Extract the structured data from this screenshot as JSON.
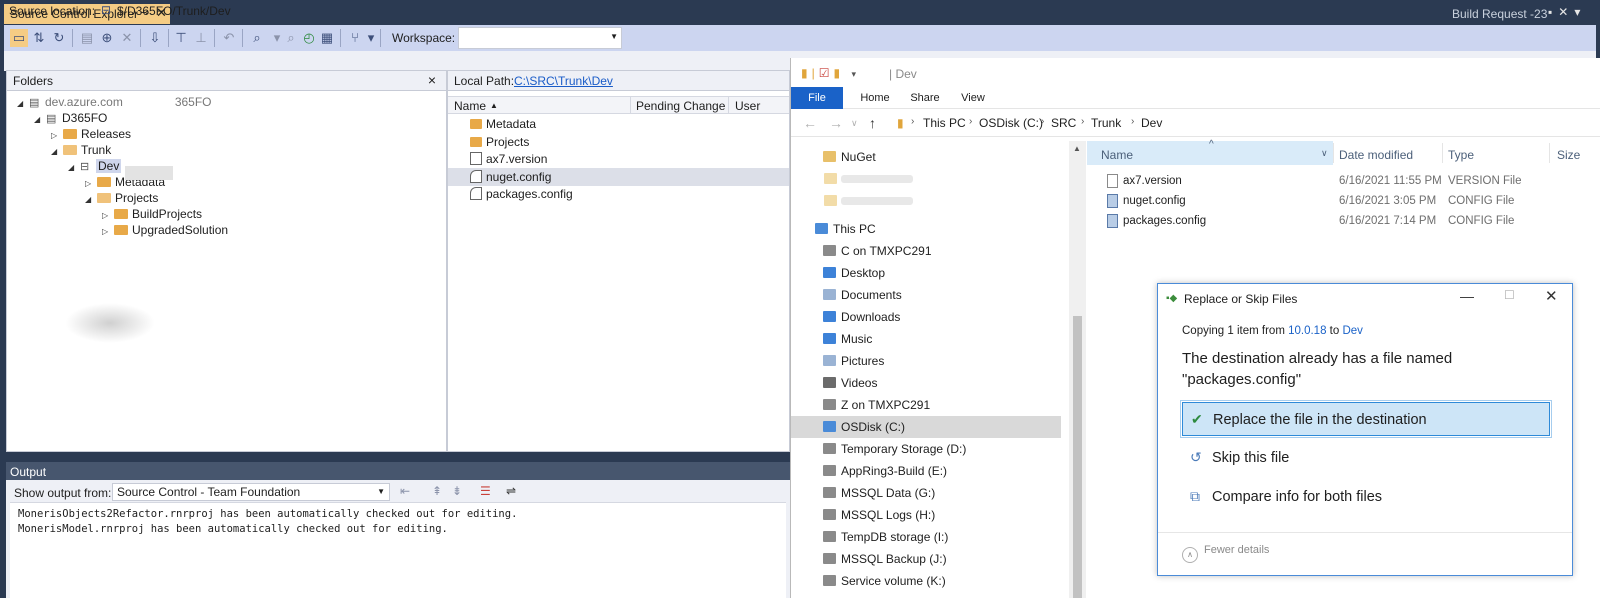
{
  "titlebar": {
    "tab_label": "Source Control Explorer",
    "pin_icon": "pin-icon",
    "close_icon": "close-icon",
    "right_label": "Build Request -23"
  },
  "toolbar": {
    "workspace_label": "Workspace:",
    "workspace_value": ""
  },
  "source_location": {
    "label": "Source location:",
    "path": "$/D365FO/Trunk/Dev"
  },
  "folders": {
    "title": "Folders",
    "tree": [
      {
        "label": "dev.azure.com",
        "suffix": "365FO",
        "indent": 0,
        "twisty": "◢",
        "icon": "server"
      },
      {
        "label": "D365FO",
        "indent": 1,
        "twisty": "◢",
        "icon": "server"
      },
      {
        "label": "Releases",
        "indent": 2,
        "twisty": "▷",
        "icon": "folder"
      },
      {
        "label": "Trunk",
        "indent": 2,
        "twisty": "◢",
        "icon": "folder-open"
      },
      {
        "label": "Dev",
        "indent": 3,
        "twisty": "◢",
        "icon": "branch",
        "selected": true
      },
      {
        "label": "Metadata",
        "indent": 4,
        "twisty": "▷",
        "icon": "folder"
      },
      {
        "label": "Projects",
        "indent": 4,
        "twisty": "◢",
        "icon": "folder-open"
      },
      {
        "label": "BuildProjects",
        "indent": 5,
        "twisty": "▷",
        "icon": "folder"
      },
      {
        "label": "UpgradedSolution",
        "indent": 5,
        "twisty": "▷",
        "icon": "folder"
      }
    ]
  },
  "items": {
    "local_path_label": "Local Path:",
    "local_path": "C:\\SRC\\Trunk\\Dev",
    "columns": [
      "Name",
      "Pending Change",
      "User"
    ],
    "rows": [
      {
        "name": "Metadata",
        "type": "folder"
      },
      {
        "name": "Projects",
        "type": "folder"
      },
      {
        "name": "ax7.version",
        "type": "doc"
      },
      {
        "name": "nuget.config",
        "type": "cfg",
        "selected": true
      },
      {
        "name": "packages.config",
        "type": "cfg"
      }
    ]
  },
  "output": {
    "title": "Output",
    "show_label": "Show output from:",
    "source": "Source Control - Team Foundation",
    "lines": [
      "MonerisObjects2Refactor.rnrproj has been automatically checked out for editing.",
      "MonerisModel.rnrproj has been automatically checked out for editing."
    ]
  },
  "explorer": {
    "window_title": "Dev",
    "ribbon_tabs": [
      "File",
      "Home",
      "Share",
      "View"
    ],
    "breadcrumb": [
      "This PC",
      "OSDisk (C:)",
      "SRC",
      "Trunk",
      "Dev"
    ],
    "nav_items": [
      {
        "label": "NuGet",
        "icon": "folder-icon",
        "color": "#e8c06a"
      },
      {
        "label": "This PC",
        "icon": "computer-icon",
        "color": "#4a8bd8"
      },
      {
        "label": "C on TMXPC291",
        "icon": "network-drive-icon",
        "color": "#8a8a8a"
      },
      {
        "label": "Desktop",
        "icon": "desktop-icon",
        "color": "#3d82d8"
      },
      {
        "label": "Documents",
        "icon": "documents-icon",
        "color": "#9ab3d4"
      },
      {
        "label": "Downloads",
        "icon": "downloads-icon",
        "color": "#3d82d8"
      },
      {
        "label": "Music",
        "icon": "music-icon",
        "color": "#3d82d8"
      },
      {
        "label": "Pictures",
        "icon": "pictures-icon",
        "color": "#9ab3d4"
      },
      {
        "label": "Videos",
        "icon": "videos-icon",
        "color": "#6b6b6b"
      },
      {
        "label": "Z on TMXPC291",
        "icon": "network-drive-icon",
        "color": "#8a8a8a"
      },
      {
        "label": "OSDisk (C:)",
        "icon": "drive-icon",
        "color": "#4a8bd8",
        "selected": true
      },
      {
        "label": "Temporary Storage (D:)",
        "icon": "drive-icon",
        "color": "#8a8a8a"
      },
      {
        "label": "AppRing3-Build (E:)",
        "icon": "drive-icon",
        "color": "#8a8a8a"
      },
      {
        "label": "MSSQL Data (G:)",
        "icon": "drive-icon",
        "color": "#8a8a8a"
      },
      {
        "label": "MSSQL Logs (H:)",
        "icon": "drive-icon",
        "color": "#8a8a8a"
      },
      {
        "label": "TempDB storage (I:)",
        "icon": "drive-icon",
        "color": "#8a8a8a"
      },
      {
        "label": "MSSQL Backup (J:)",
        "icon": "drive-icon",
        "color": "#8a8a8a"
      },
      {
        "label": "Service volume (K:)",
        "icon": "drive-icon",
        "color": "#8a8a8a"
      }
    ],
    "columns": [
      "Name",
      "Date modified",
      "Type",
      "Size"
    ],
    "files": [
      {
        "name": "ax7.version",
        "date": "6/16/2021 11:55 PM",
        "type": "VERSION File",
        "icon": "doc"
      },
      {
        "name": "nuget.config",
        "date": "6/16/2021 3:05 PM",
        "type": "CONFIG File",
        "icon": "cfg"
      },
      {
        "name": "packages.config",
        "date": "6/16/2021 7:14 PM",
        "type": "CONFIG File",
        "icon": "cfg"
      }
    ]
  },
  "dialog": {
    "title": "Replace or Skip Files",
    "copy_prefix": "Copying 1 item from ",
    "copy_from": "10.0.18",
    "copy_to_word": " to ",
    "copy_to": "Dev",
    "message": "The destination already has a file named \"packages.config\"",
    "options": [
      {
        "label": "Replace the file in the destination",
        "icon": "checkmark-icon"
      },
      {
        "label": "Skip this file",
        "icon": "skip-arrow-icon"
      },
      {
        "label": "Compare info for both files",
        "icon": "compare-icon"
      }
    ],
    "fewer_details": "Fewer details"
  }
}
